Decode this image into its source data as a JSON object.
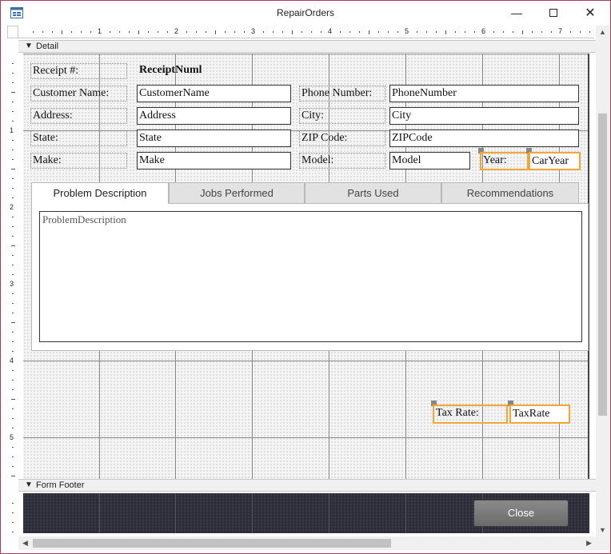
{
  "window": {
    "title": "RepairOrders"
  },
  "ruler": {
    "marks": [
      "1",
      "2",
      "3",
      "4",
      "5",
      "6",
      "7"
    ],
    "vmarks": [
      "1",
      "2",
      "3",
      "4",
      "5"
    ]
  },
  "sections": {
    "detail": "Detail",
    "form_footer": "Form Footer"
  },
  "fields": {
    "receipt_label": "Receipt #:",
    "receipt_value": "ReceiptNuml",
    "customer_label": "Customer Name:",
    "customer_value": "CustomerName",
    "phone_label": "Phone Number:",
    "phone_value": "PhoneNumber",
    "address_label": "Address:",
    "address_value": "Address",
    "city_label": "City:",
    "city_value": "City",
    "state_label": "State:",
    "state_value": "State",
    "zip_label": "ZIP Code:",
    "zip_value": "ZIPCode",
    "make_label": "Make:",
    "make_value": "Make",
    "model_label": "Model:",
    "model_value": "Model",
    "year_label": "Year:",
    "year_value": "CarYear",
    "taxrate_label": "Tax Rate:",
    "taxrate_value": "TaxRate"
  },
  "tabs": [
    {
      "label": "Problem Description",
      "active": true
    },
    {
      "label": "Jobs Performed",
      "active": false
    },
    {
      "label": "Parts Used",
      "active": false
    },
    {
      "label": "Recommendations",
      "active": false
    }
  ],
  "problem_description": "ProblemDescription",
  "footer": {
    "close_label": "Close"
  },
  "colors": {
    "selection": "#f3a536",
    "window_border": "#b0395a",
    "footer_bg": "#2d2d3a"
  }
}
